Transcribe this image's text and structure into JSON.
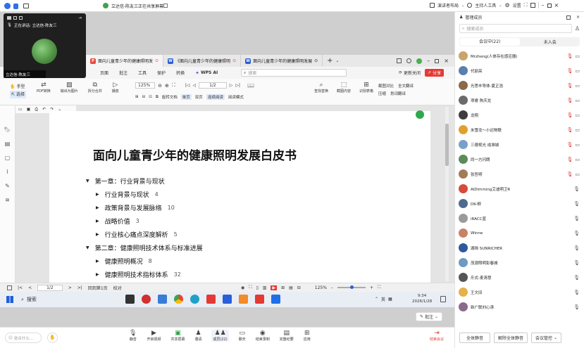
{
  "topbar": {
    "share_status": "立达信-陈友三正在共享屏幕",
    "right_items": [
      "演讲者布局",
      "主持人工具",
      "设置"
    ]
  },
  "video": {
    "speaking": "正在讲话: 立达信-陈友三",
    "name": "立达信-陈友三"
  },
  "wps": {
    "tabs": [
      "面向儿童青少年的健康照明发",
      "《面向儿童青少年的健康照明",
      "面向儿童青少年的健康照明发展"
    ],
    "menu": [
      "页面",
      "批注",
      "工具",
      "保护",
      "转换",
      "WPS AI"
    ],
    "search_placeholder": "搜索",
    "update": "更新关闭",
    "share": "分享",
    "ribbon_left": [
      "手型",
      "选择"
    ],
    "ribbon_buttons": [
      "PDF转换",
      "输出为图片",
      "拆分合并",
      "播放"
    ],
    "zoom": "125%",
    "page_input": "1/2",
    "ribbon_mid": [
      "旋转文档",
      "单页",
      "双页",
      "连续阅读",
      "阅读模式"
    ],
    "ribbon_right": [
      "查找替换",
      "截图内容",
      "识别表格",
      "截图对比",
      "压缩",
      "全文翻译",
      "划词翻译"
    ]
  },
  "document": {
    "title": "面向儿童青少年的健康照明发展白皮书",
    "outline": [
      {
        "level": 1,
        "text": "第一章：行业背景与现状",
        "count": ""
      },
      {
        "level": 2,
        "text": "行业背景与现状",
        "count": "4"
      },
      {
        "level": 2,
        "text": "政策背景与发展脉络",
        "count": "10"
      },
      {
        "level": 2,
        "text": "战略价值",
        "count": "3"
      },
      {
        "level": 2,
        "text": "行业核心痛点深度解析",
        "count": "5"
      },
      {
        "level": 1,
        "text": "第二章：健康照明技术体系与标准进展",
        "count": ""
      },
      {
        "level": 2,
        "text": "健康照明概况",
        "count": "8"
      },
      {
        "level": 2,
        "text": "健康照明技术指标体系",
        "count": "32"
      }
    ]
  },
  "statusbar": {
    "page": "1/2",
    "page_label": "回到第1页",
    "mode": "校对",
    "zoom": "125%"
  },
  "taskbar": {
    "search": "搜索",
    "ime": "英",
    "time": "9:34",
    "date": "2026/1/28"
  },
  "meeting": {
    "chat_placeholder": "说点什么...",
    "controls": [
      "静音",
      "开启视频",
      "共享屏幕",
      "邀请",
      "成员(22)",
      "聊天",
      "结束录制",
      "完整纪要",
      "应用"
    ],
    "end": "结束会议",
    "annotate": "批注",
    "accent": "#e53935"
  },
  "members_panel": {
    "title": "管理成员",
    "search_placeholder": "搜索成员",
    "tab_in": "会议中(22)",
    "tab_out": "未入会",
    "members": [
      "Mrzheng(人体存在感应器)",
      "代丽亮",
      "光思丰导体-夏正浩",
      "项睿 陈庆龙",
      "龙翔",
      "米雪龙～小迟物联",
      "三德视光 成淮城",
      "同一方闪朗",
      "张哲明",
      "AIDimming艾迪明卫R",
      "DK-柳",
      "iRACC蓝",
      "Winne",
      "湖旸 SUNRICHER",
      "茂源照明彭春城",
      "乐式-麦清慧",
      "王文旧",
      "新广联刘心涛"
    ],
    "buttons": [
      "全体静音",
      "解除全体静音",
      "会议管控"
    ]
  }
}
